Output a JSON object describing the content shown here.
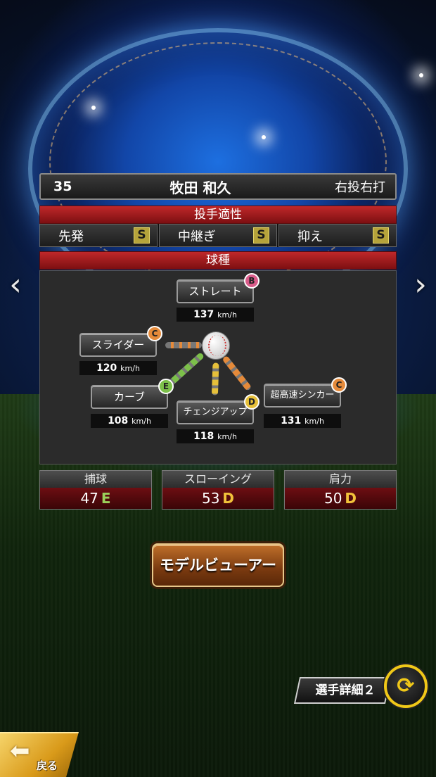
{
  "player": {
    "number": "35",
    "name": "牧田 和久",
    "throw_bat": "右投右打"
  },
  "aptitude": {
    "title": "投手適性",
    "roles": [
      {
        "label": "先発",
        "grade": "S"
      },
      {
        "label": "中継ぎ",
        "grade": "S"
      },
      {
        "label": "抑え",
        "grade": "S"
      }
    ]
  },
  "pitches": {
    "title": "球種",
    "items": [
      {
        "name": "ストレート",
        "speed": "137",
        "unit": "km/h",
        "grade": "B"
      },
      {
        "name": "スライダー",
        "speed": "120",
        "unit": "km/h",
        "grade": "C"
      },
      {
        "name": "カーブ",
        "speed": "108",
        "unit": "km/h",
        "grade": "E"
      },
      {
        "name": "チェンジアップ",
        "speed": "118",
        "unit": "km/h",
        "grade": "D"
      },
      {
        "name": "超高速シンカー",
        "speed": "131",
        "unit": "km/h",
        "grade": "C"
      }
    ]
  },
  "stats": [
    {
      "label": "捕球",
      "value": "47",
      "grade": "E"
    },
    {
      "label": "スローイング",
      "value": "53",
      "grade": "D"
    },
    {
      "label": "肩力",
      "value": "50",
      "grade": "D"
    }
  ],
  "buttons": {
    "model_viewer": "モデルビューアー",
    "player_detail": "選手詳細２",
    "back": "戻る"
  },
  "icons": {
    "prev": "chevron-left-icon",
    "next": "chevron-right-icon",
    "swap": "swap-cycle-icon",
    "back": "back-arrow-icon"
  },
  "colors": {
    "section_red": "#c0282a",
    "grade_s": "#b5a33b",
    "grade_b": "#d95c8a",
    "grade_c": "#e58a3a",
    "grade_d": "#e6c03a",
    "grade_e": "#7cc04a",
    "button_gold": "#f0c818"
  }
}
